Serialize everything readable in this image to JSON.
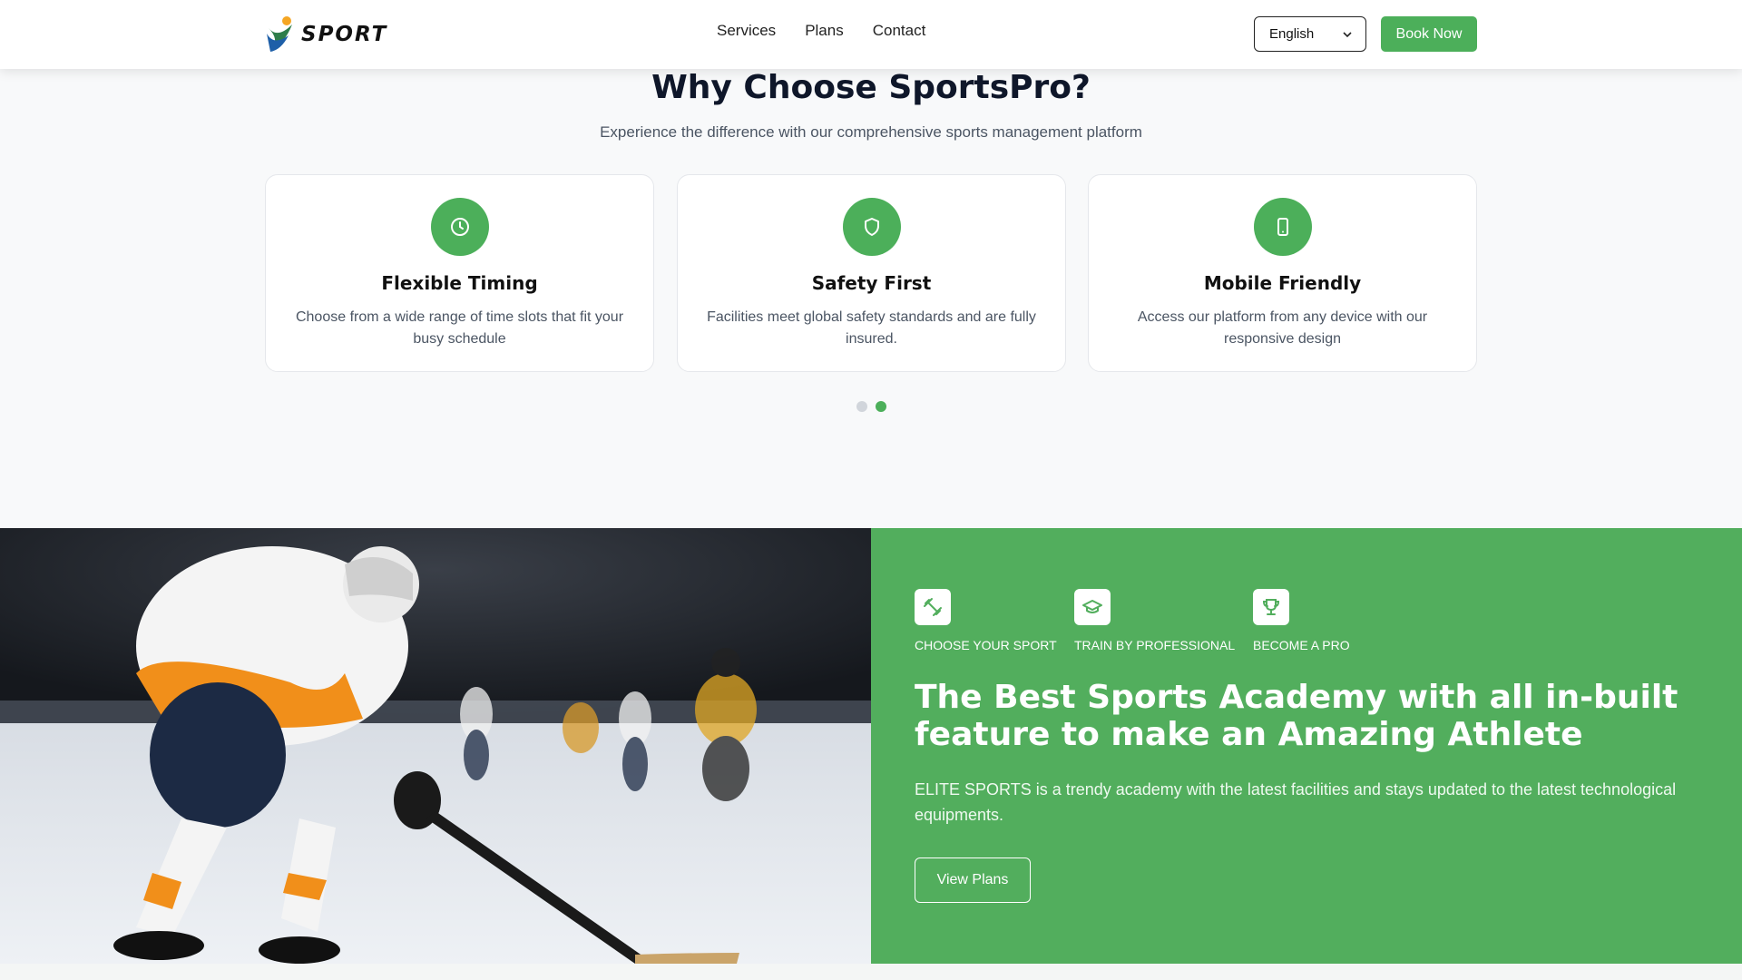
{
  "header": {
    "logo_text": "SPORT",
    "nav": [
      "Services",
      "Plans",
      "Contact"
    ],
    "language": "English",
    "book_label": "Book Now"
  },
  "why": {
    "title": "Why Choose SportsPro?",
    "subtitle": "Experience the difference with our comprehensive sports management platform",
    "cards": [
      {
        "icon": "clock-icon",
        "title": "Flexible Timing",
        "text": "Choose from a wide range of time slots that fit your busy schedule"
      },
      {
        "icon": "shield-icon",
        "title": "Safety First",
        "text": "Facilities meet global safety standards and are fully insured."
      },
      {
        "icon": "smartphone-icon",
        "title": "Mobile Friendly",
        "text": "Access our platform from any device with our responsive design"
      }
    ],
    "carousel": {
      "pages": 2,
      "active": 2
    }
  },
  "academy": {
    "features": [
      {
        "icon": "dumbbell-icon",
        "label": "CHOOSE YOUR SPORT"
      },
      {
        "icon": "graduation-cap-icon",
        "label": "TRAIN BY PROFESSIONAL"
      },
      {
        "icon": "trophy-icon",
        "label": "BECOME A PRO"
      }
    ],
    "heading": "The Best Sports Academy with all in-built feature to make an Amazing Athlete",
    "description": "ELITE SPORTS is a trendy academy with the latest facilities and stays updated to the latest technological equipments.",
    "cta_label": "View Plans"
  },
  "colors": {
    "accent": "#4caf5a",
    "section_green": "#52ae5d"
  }
}
